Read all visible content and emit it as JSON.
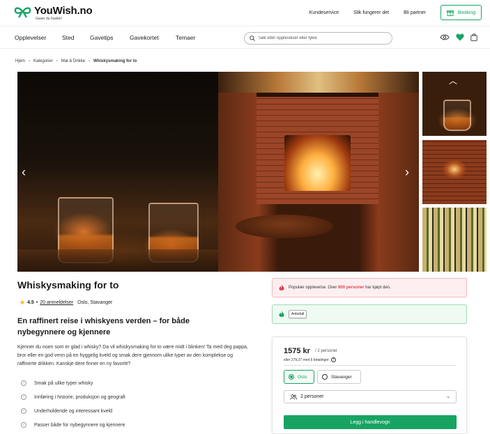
{
  "brand": {
    "name": "YouWish.no",
    "tagline": "Gaver du husker!"
  },
  "topbar": {
    "links": [
      "Kundeservice",
      "Slik fungerer det",
      "Bli partner"
    ],
    "booking_label": "Booking"
  },
  "nav": {
    "items": [
      "Opplevelser",
      "Sted",
      "Gavetips",
      "Gavekortet",
      "Temaer"
    ],
    "search_placeholder": "Søk etter opplevelser eller fylke"
  },
  "breadcrumb": [
    "Hjem",
    "Kategorier",
    "Mat & Drikke",
    "Whiskysmaking for to"
  ],
  "gallery": {
    "slide_count": 3,
    "active_slide": 1
  },
  "product": {
    "title": "Whiskysmaking for to",
    "rating": "4.5",
    "reviews_link": "20 anmeldelser",
    "locations": "Oslo, Stavanger",
    "subtitle": "En raffinert reise i whiskyens verden – for både nybegynnere og kjennere",
    "description": "Kjenner du noen som er glad i whisky? Da vil whiskysmaking for to være midt i blinken! Ta med deg pappa, bror eller en god venn på en hyggelig kveld og smak dere gjennom ulike typer av den komplekse og raffinerte drikken. Kanskje dere finner en ny favoritt?",
    "features": [
      "Smak på ulike typer whisky",
      "Innføring i historie, produksjon og geografi",
      "Underholdende og interessant kveld",
      "Passer både for nybegynnere og kjennere"
    ]
  },
  "popular": {
    "text_before": "Populær opplevelse. Over ",
    "highlight": "800 personer",
    "text_after": " har kjøpt den."
  },
  "recommended": {
    "badge": "Anbefalt"
  },
  "booking_card": {
    "price": "1575 kr",
    "per": "/ 2 personer",
    "installment": "eller 279,27 med 6 betalinger",
    "location_options": [
      {
        "label": "Oslo",
        "selected": true
      },
      {
        "label": "Stavanger",
        "selected": false
      }
    ],
    "persons_value": "2 personer",
    "add_to_cart": "Legg i handlevogn"
  },
  "colors": {
    "brand_green": "#19a463",
    "popular_red": "#e0464f",
    "star": "#f5b301"
  }
}
